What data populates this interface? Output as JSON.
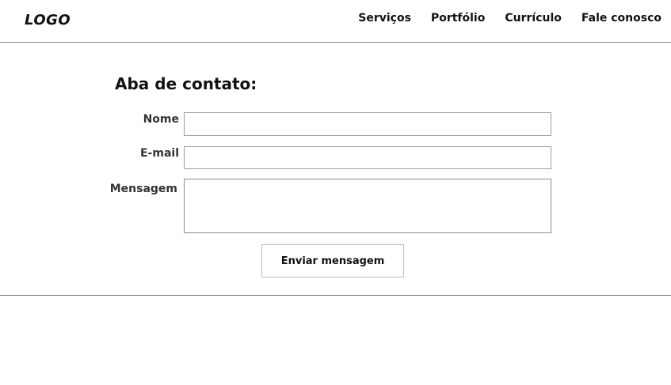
{
  "header": {
    "logo": "LOGO",
    "nav": [
      {
        "label": "Serviços"
      },
      {
        "label": "Portfólio"
      },
      {
        "label": "Currículo"
      },
      {
        "label": "Fale conosco"
      }
    ]
  },
  "form": {
    "title": "Aba de contato:",
    "fields": {
      "name_label": "Nome",
      "name_value": "",
      "email_label": "E-mail",
      "email_value": "",
      "message_label": "Mensagem",
      "message_value": ""
    },
    "submit_label": "Enviar mensagem"
  }
}
